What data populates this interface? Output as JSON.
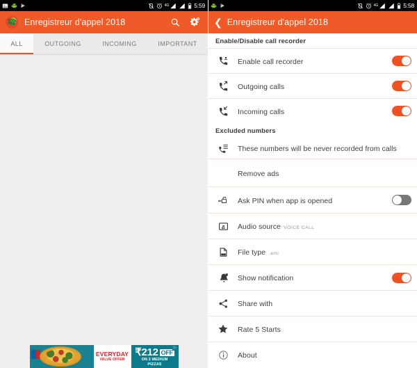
{
  "status_bar": {
    "left_icons": [
      "image-icon",
      "android-robot-icon",
      "play-flag-icon"
    ],
    "right_icons": [
      "no-vibrate-icon",
      "alarm-icon",
      "signal-4g-icon",
      "signal-bars-icon",
      "battery-icon"
    ],
    "network_label": "4G",
    "time_left": "5:59",
    "time_right": "5:58"
  },
  "left_screen": {
    "appbar": {
      "logo": "call-recorder-logo-icon",
      "title": "Enregistreur d'appel 2018",
      "search_icon": "search-icon",
      "settings_icon": "gear-icon"
    },
    "tabs": [
      {
        "label": "ALL",
        "selected": true
      },
      {
        "label": "OUTGOING",
        "selected": false
      },
      {
        "label": "INCOMING",
        "selected": false
      },
      {
        "label": "IMPORTANT",
        "selected": false
      }
    ],
    "ad": {
      "brand": "dominos-logo-icon",
      "headline_line1": "EVERYDAY",
      "headline_line2": "VALUE OFFER",
      "price": "₹212",
      "off_label": "OFF",
      "sub_line1": "ON 2 MEDIUM",
      "sub_line2": "PIZZAS",
      "adchoices": "▷"
    }
  },
  "right_screen": {
    "appbar": {
      "back_icon": "back-chevron-icon",
      "title": "Enregistreur d'appel 2018"
    },
    "sections": [
      {
        "header": "Enable/Disable call recorder"
      },
      {
        "header": "Excluded numbers"
      }
    ],
    "rows": {
      "enable_call_recorder": {
        "icon": "phone-record-icon",
        "title": "Enable call recorder",
        "toggle": "on"
      },
      "outgoing_calls": {
        "icon": "phone-outgoing-icon",
        "title": "Outgoing calls",
        "toggle": "on"
      },
      "incoming_calls": {
        "icon": "phone-incoming-icon",
        "title": "Incoming calls",
        "toggle": "on"
      },
      "excluded_numbers": {
        "icon": "phone-list-icon",
        "title": "These numbers will be never recorded from calls"
      },
      "remove_ads": {
        "title": "Remove ads"
      },
      "ask_pin": {
        "icon": "lock-icon",
        "title": "Ask PIN when app is opened",
        "toggle": "off"
      },
      "audio_source": {
        "icon": "audio-folder-icon",
        "title": "Audio source",
        "value": "VOICE CALL"
      },
      "file_type": {
        "icon": "file-icon",
        "title": "File type",
        "value": ".amr"
      },
      "show_notification": {
        "icon": "notification-icon",
        "title": "Show notification",
        "toggle": "on"
      },
      "share_with": {
        "icon": "share-icon",
        "title": "Share with"
      },
      "rate": {
        "icon": "star-icon",
        "title": "Rate 5 Starts"
      },
      "about": {
        "icon": "info-icon",
        "title": "About"
      }
    }
  },
  "colors": {
    "accent": "#ef5a28",
    "toggle_on": "#ee5223",
    "toggle_off": "#777777",
    "status_bar": "#000000",
    "list_background": "#f0eeee",
    "divider": "#f2dedb"
  }
}
